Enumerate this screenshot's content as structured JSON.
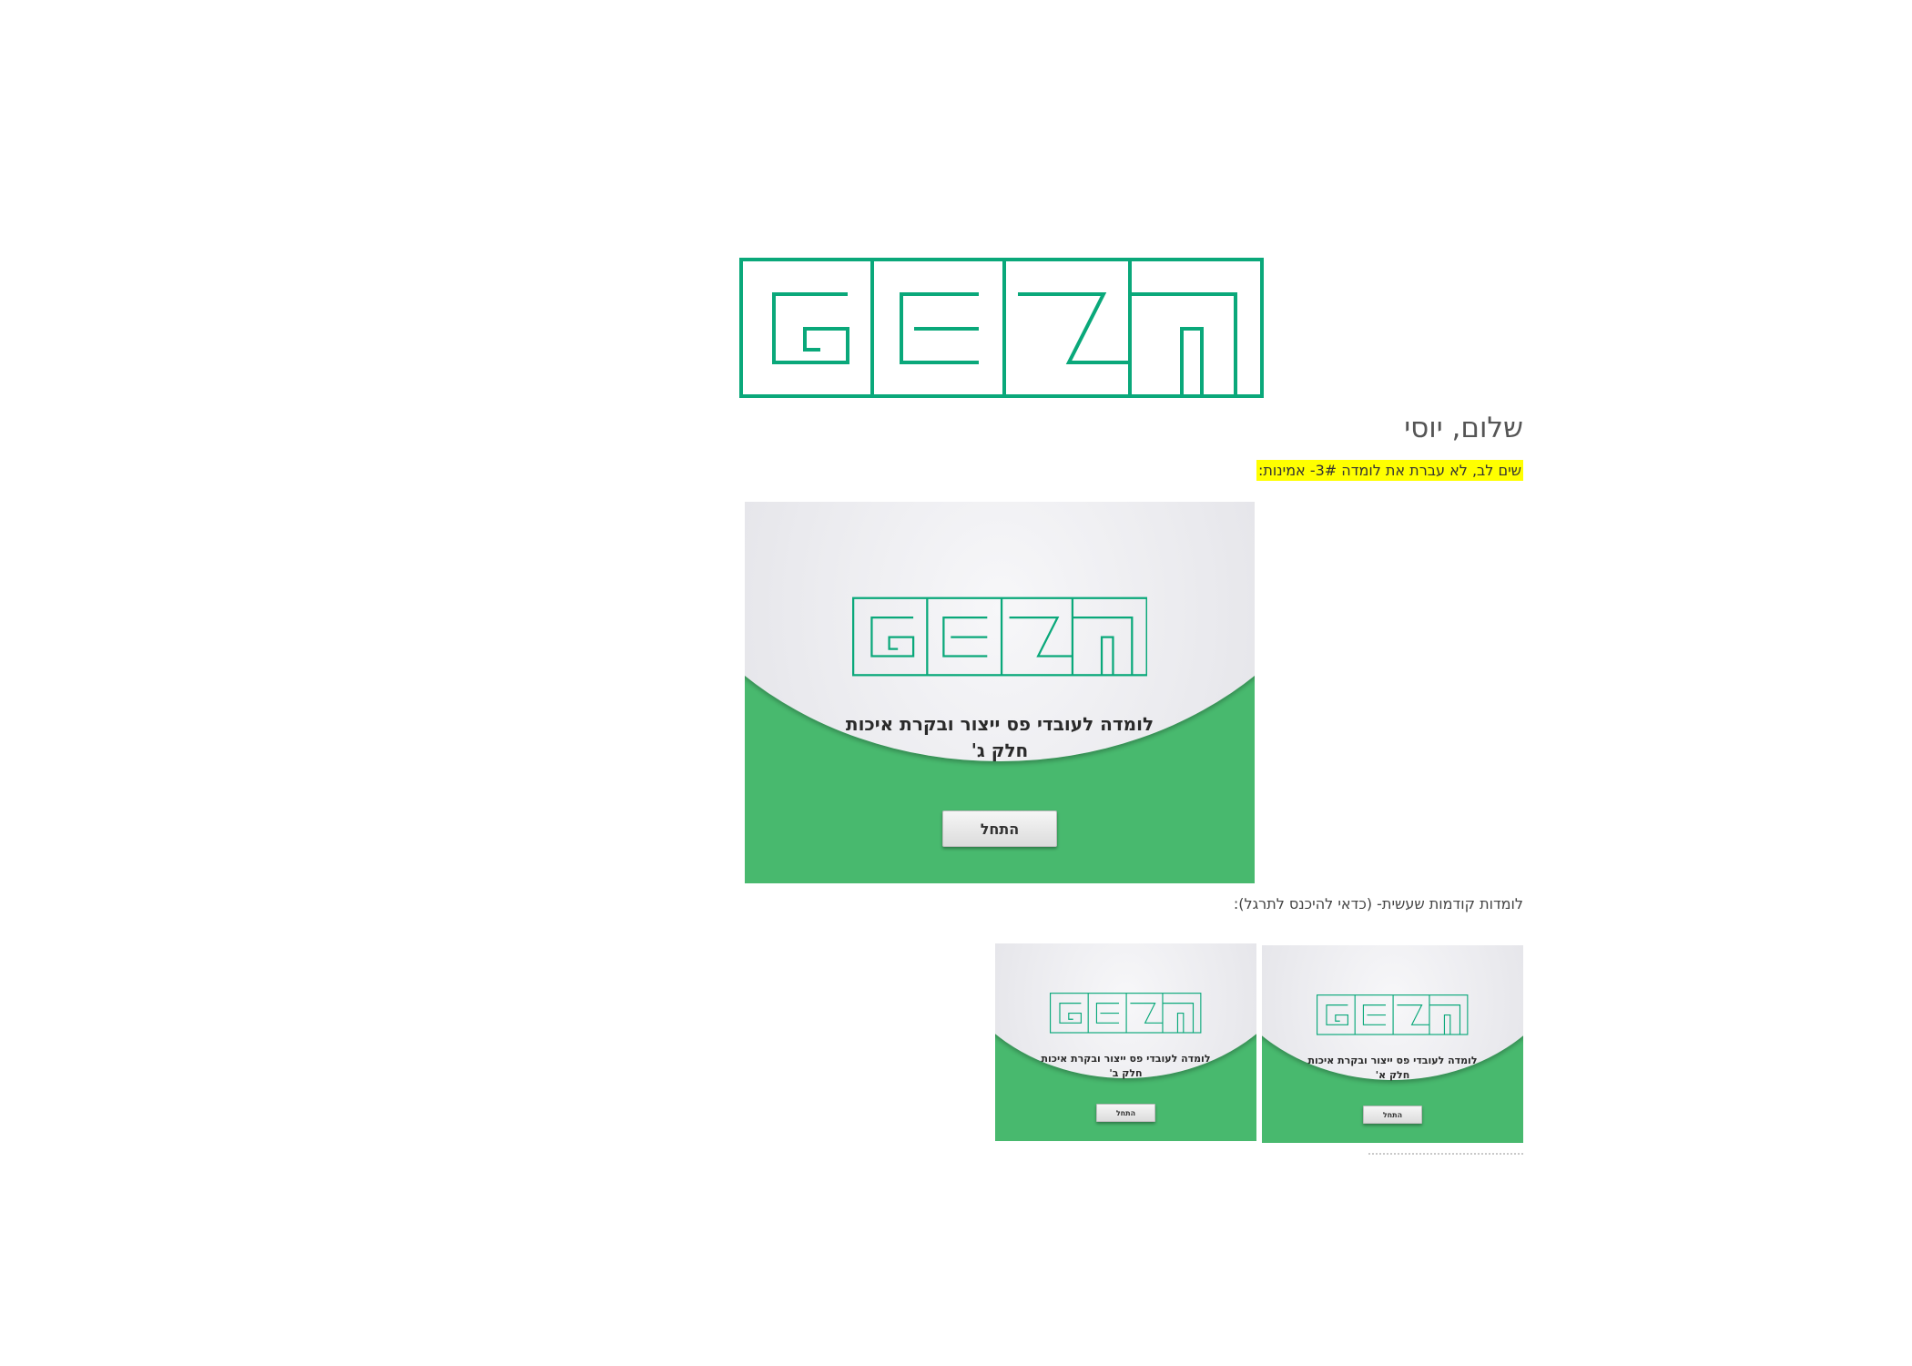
{
  "brand": {
    "logo_text": "GEZn",
    "accent_color": "#0aa87a",
    "card_green": "#48b96e"
  },
  "greeting": {
    "text": "שלום, יוסי"
  },
  "notice": {
    "text": "שים לב, לא עברת את לומדה 3#- אמינות:",
    "highlight_color": "#ffff00"
  },
  "current_course": {
    "title_line1": "לומדה לעובדי פס ייצור ובקרת איכות",
    "title_line2": "חלק ג'",
    "start_label": "התחל"
  },
  "previous_section": {
    "label": "לומדות קודמות שעשית- (כדאי להיכנס לתרגל):"
  },
  "previous_courses": [
    {
      "title_line1": "לומדה לעובדי פס ייצור ובקרת איכות",
      "title_line2": "חלק א'",
      "start_label": "התחל"
    },
    {
      "title_line1": "לומדה לעובדי פס ייצור ובקרת איכות",
      "title_line2": "חלק ב'",
      "start_label": "התחל"
    }
  ]
}
